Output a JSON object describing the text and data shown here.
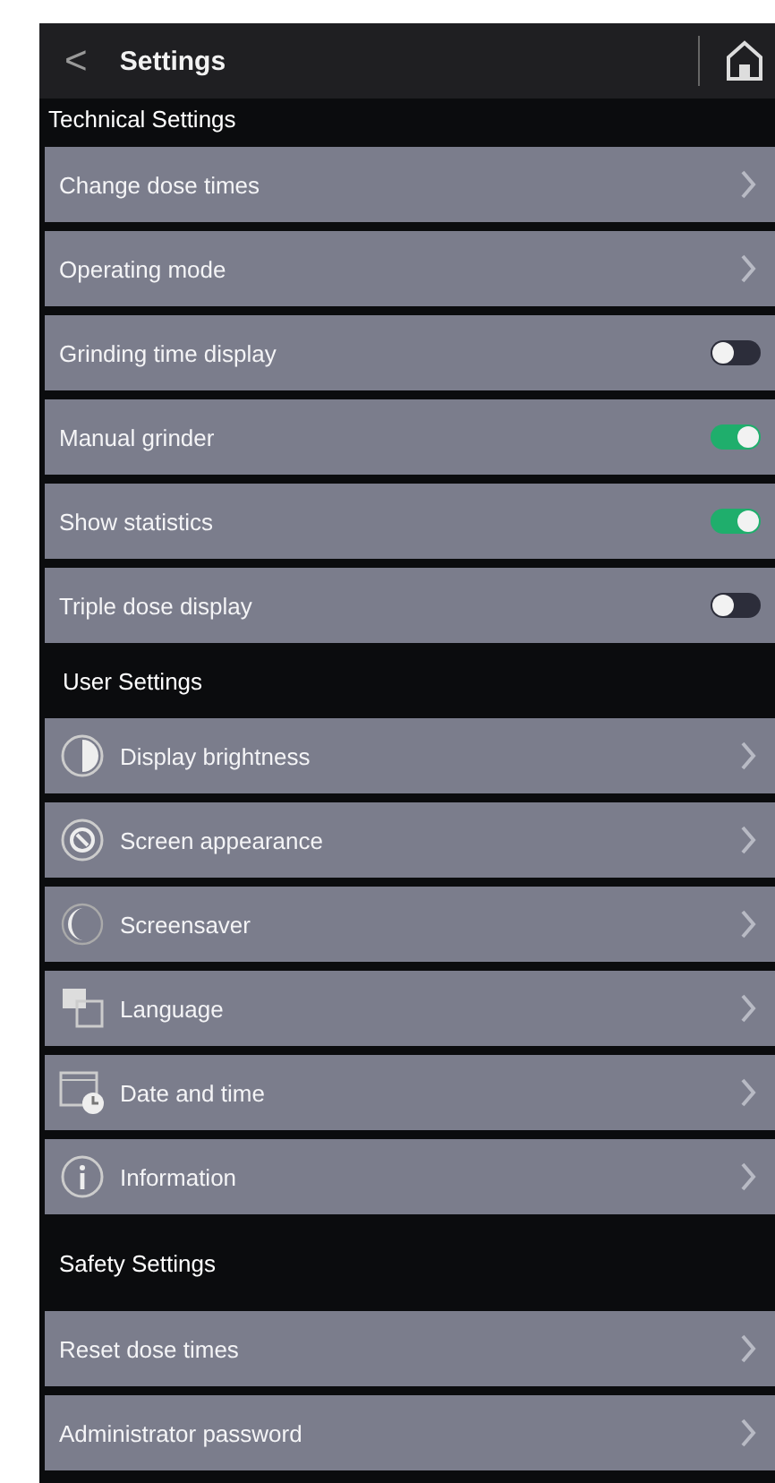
{
  "header": {
    "back": "<",
    "title": "Settings"
  },
  "sections": [
    {
      "title": "Technical Settings",
      "kind": "compact",
      "items": [
        {
          "label": "Change dose times",
          "kind": "link"
        },
        {
          "label": "Operating mode",
          "kind": "link"
        },
        {
          "label": "Grinding time display",
          "kind": "toggle",
          "on": false
        },
        {
          "label": "Manual grinder",
          "kind": "toggle",
          "on": true
        },
        {
          "label": "Show statistics",
          "kind": "toggle",
          "on": true
        },
        {
          "label": "Triple dose display",
          "kind": "toggle",
          "on": false
        }
      ]
    },
    {
      "title": "User Settings",
      "kind": "indented",
      "items": [
        {
          "label": "Display brightness",
          "kind": "link"
        },
        {
          "label": "Screen appearance",
          "kind": "link"
        },
        {
          "label": "Screensaver",
          "kind": "link"
        },
        {
          "label": "Language",
          "kind": "link"
        },
        {
          "label": "Date and time",
          "kind": "link"
        },
        {
          "label": "Information",
          "kind": "link"
        }
      ]
    },
    {
      "title": "Safety Settings",
      "kind": "tall",
      "items": [
        {
          "label": "Reset dose times",
          "kind": "link"
        },
        {
          "label": "Administrator password",
          "kind": "link"
        }
      ]
    }
  ]
}
